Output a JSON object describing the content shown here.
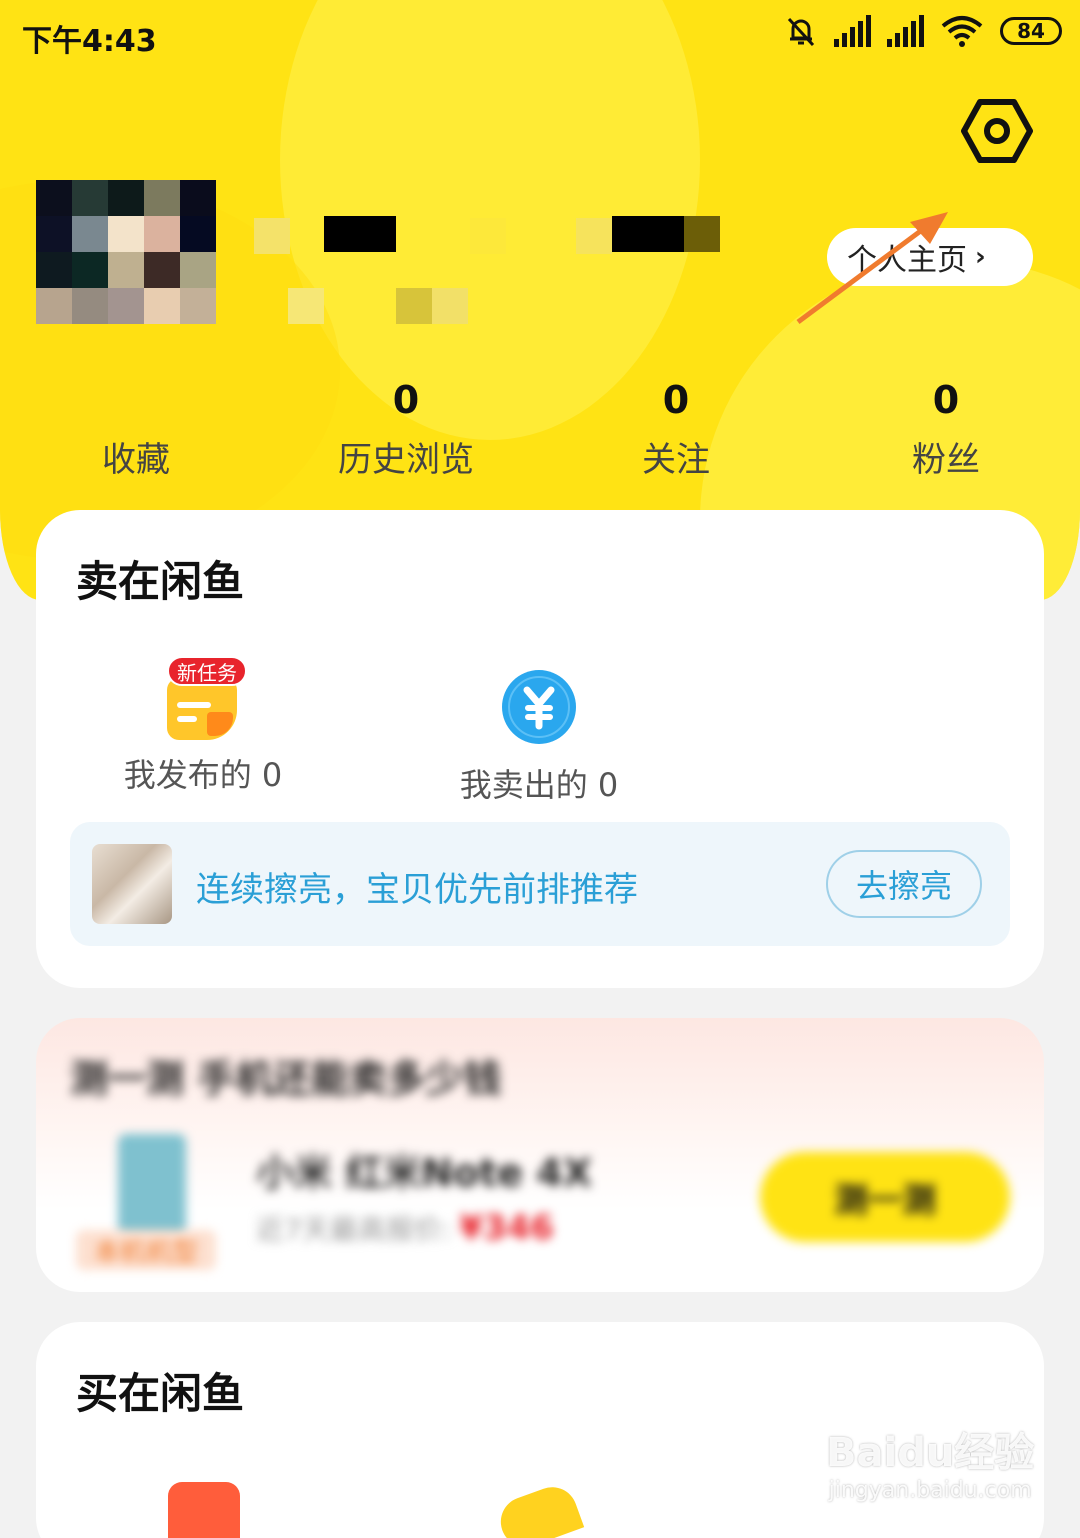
{
  "status_bar": {
    "time": "下午4:43",
    "battery": "84",
    "icons": [
      "bell-muted-icon",
      "signal-icon",
      "signal-icon",
      "wifi-icon",
      "battery-icon"
    ]
  },
  "header": {
    "settings_icon": "hexagon-gear-icon",
    "profile_link": "个人主页",
    "chevron": "›"
  },
  "stats": [
    {
      "value": "",
      "label": "收藏"
    },
    {
      "value": "0",
      "label": "历史浏览"
    },
    {
      "value": "0",
      "label": "关注"
    },
    {
      "value": "0",
      "label": "粉丝"
    }
  ],
  "sell_section": {
    "title": "卖在闲鱼",
    "badge": "新任务",
    "shortcuts": [
      {
        "label": "我发布的 0",
        "icon": "published-icon"
      },
      {
        "label": "我卖出的 0",
        "icon": "yen-coin-icon"
      }
    ],
    "promo": {
      "text": "连续擦亮，宝贝优先前排推荐",
      "button": "去擦亮"
    }
  },
  "estimate_card": {
    "title": "测一测 手机还能卖多少钱",
    "product": "小米 红米Note 4X",
    "price_text": "近7天最高报价:",
    "price": "¥346",
    "button": "测一测",
    "tag": "本机机型"
  },
  "buy_section": {
    "title": "买在闲鱼"
  },
  "watermark": {
    "brand": "Baidu经验",
    "url": "jingyan.baidu.com"
  },
  "colors": {
    "brand_yellow": "#ffe314",
    "link_blue": "#2a9fd6",
    "badge_red": "#e8242c",
    "annotation_orange": "#f07b2e"
  }
}
